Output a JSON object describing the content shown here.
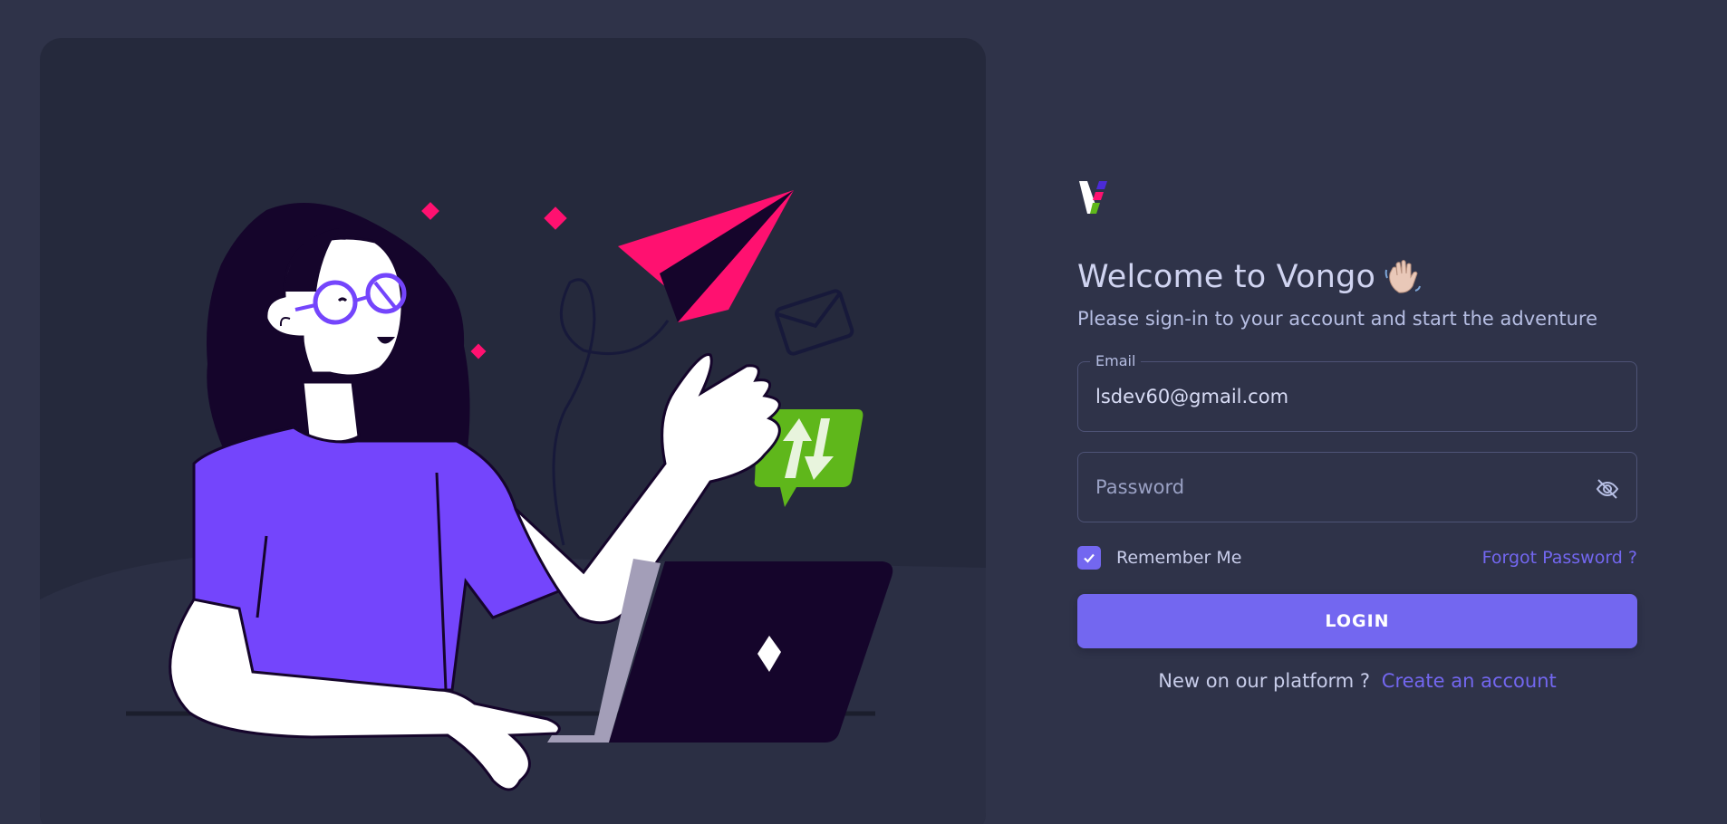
{
  "brand": {
    "logo_icon": "vongo-v-logo-icon",
    "accent_color": "#7367f0"
  },
  "login": {
    "title": "Welcome to Vongo",
    "wave_icon": "waving-hand-emoji-icon",
    "subtitle": "Please sign-in to your account and start the adventure",
    "email": {
      "label": "Email",
      "value": "lsdev60@gmail.com"
    },
    "password": {
      "placeholder": "Password",
      "toggle_icon": "eye-off-icon"
    },
    "remember_me": {
      "label": "Remember Me",
      "checked": true
    },
    "forgot_password": "Forgot Password ?",
    "submit_label": "LOGIN",
    "signup_prompt": "New on our platform ?",
    "signup_link": "Create an account"
  },
  "illustration": {
    "icons": [
      "paper-plane-icon",
      "envelope-icon",
      "transfer-arrows-icon",
      "laptop-icon"
    ],
    "colors": {
      "shirt": "#7445fc",
      "hair": "#15052b",
      "plane": "#ff1170",
      "badge": "#5fb71b"
    }
  }
}
